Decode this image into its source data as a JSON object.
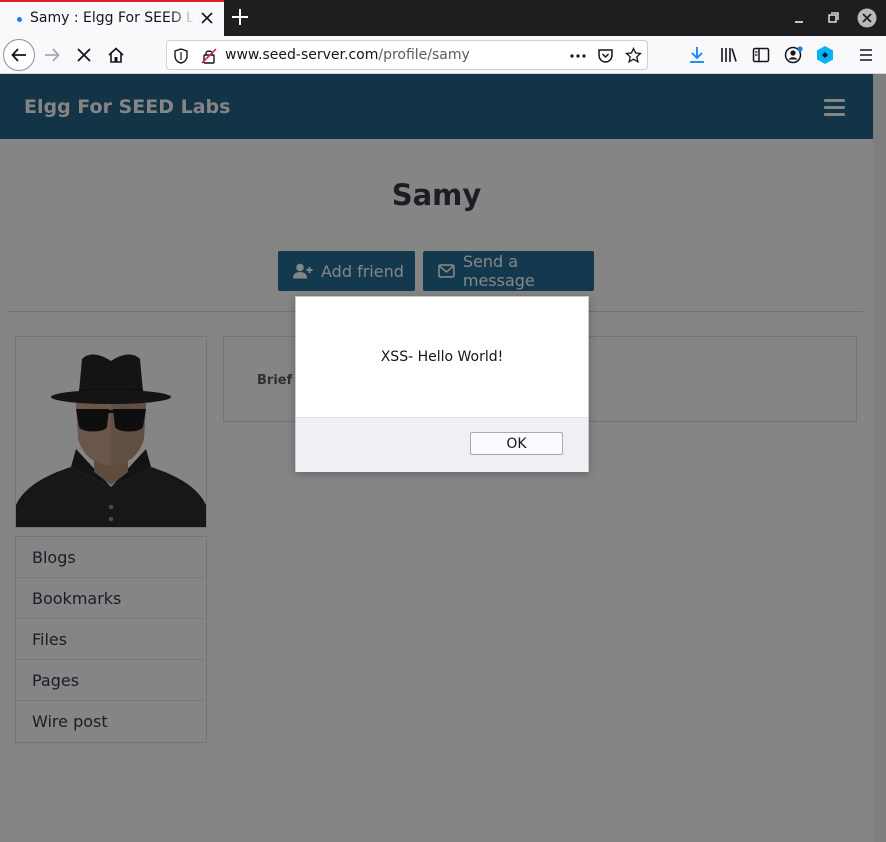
{
  "browser": {
    "tab_title": "Samy : Elgg For SEED Labs",
    "url_host": "www.seed-server.com",
    "url_path": "/profile/samy"
  },
  "site": {
    "name": "Elgg For SEED Labs"
  },
  "profile": {
    "name": "Samy",
    "add_friend_label": "Add friend",
    "send_message_label": "Send a message",
    "details_label": "Brief d"
  },
  "sidebar": {
    "items": [
      {
        "label": "Blogs"
      },
      {
        "label": "Bookmarks"
      },
      {
        "label": "Files"
      },
      {
        "label": "Pages"
      },
      {
        "label": "Wire post"
      }
    ]
  },
  "alert": {
    "message": "XSS- Hello World!",
    "ok_label": "OK"
  },
  "colors": {
    "header": "#1b5b80",
    "button": "#1b6790",
    "tab_accent": "#e01f2a"
  }
}
